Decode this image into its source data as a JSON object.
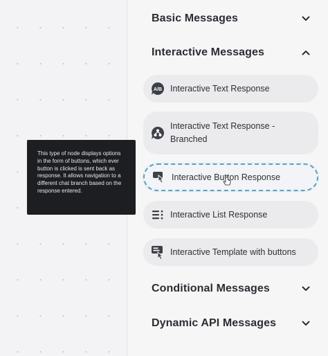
{
  "sections": {
    "basic": {
      "title": "Basic Messages",
      "expanded": false
    },
    "interactive": {
      "title": "Interactive Messages",
      "expanded": true
    },
    "conditional": {
      "title": "Conditional Messages",
      "expanded": false
    },
    "dynamic_api": {
      "title": "Dynamic API Messages",
      "expanded": false
    }
  },
  "interactive_items": [
    {
      "label": "Interactive Text Response",
      "icon": "ab-bubble-icon"
    },
    {
      "label": "Interactive Text Response - Branched",
      "icon": "branch-bubble-icon"
    },
    {
      "label": "Interactive Button Response",
      "icon": "button-tap-icon",
      "selected": true
    },
    {
      "label": "Interactive List Response",
      "icon": "list-icon"
    },
    {
      "label": "Interactive Template with buttons",
      "icon": "template-icon"
    }
  ],
  "tooltip": {
    "text": "This type of node displays options in the form of buttons, which ever button is clicked is sent back as response. It allows navigation to a different chat branch based on the response entered."
  },
  "colors": {
    "accent_dashed": "#5aa3c4",
    "icon_dark": "#3d4048",
    "tooltip_bg": "#1d1e22"
  }
}
